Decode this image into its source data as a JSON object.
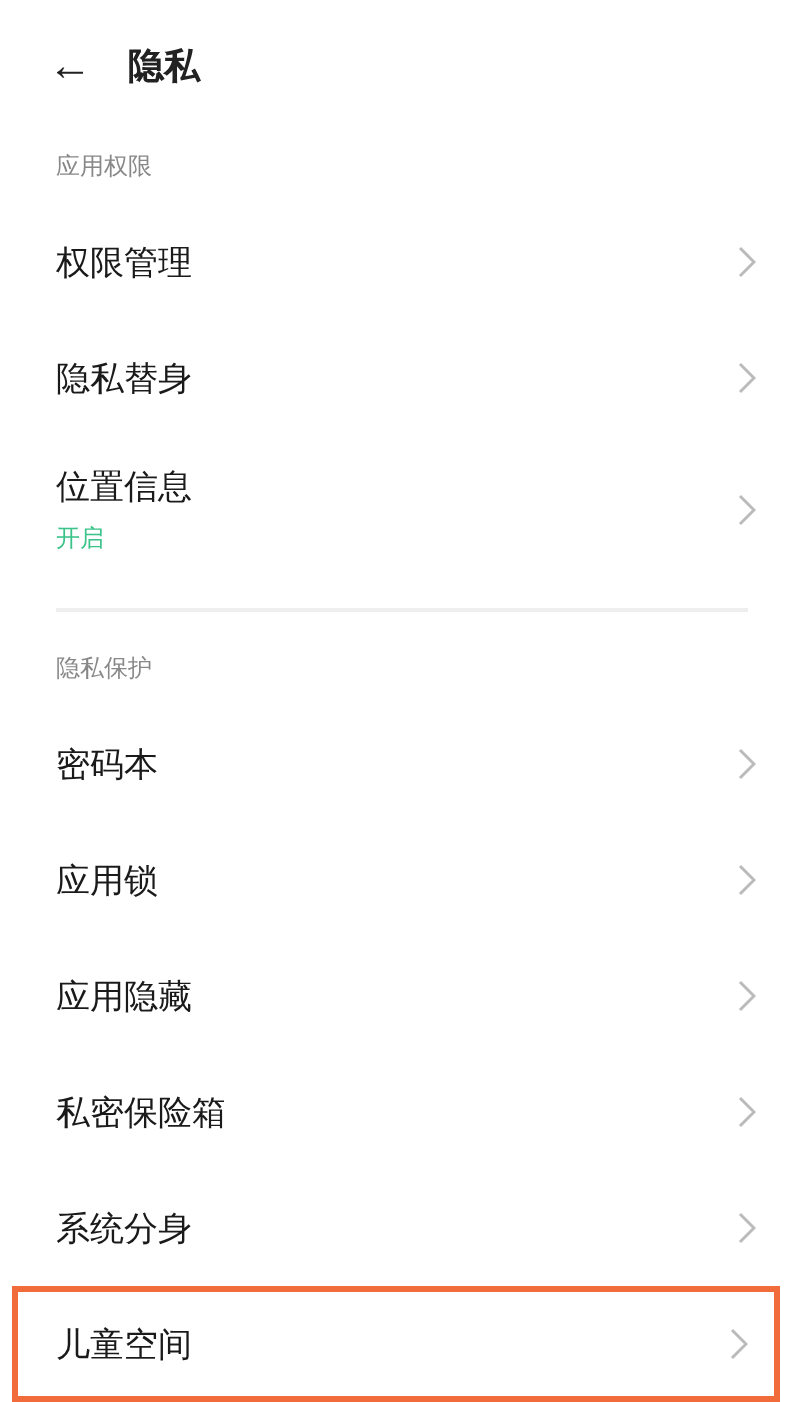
{
  "header": {
    "back_glyph": "←",
    "title": "隐私"
  },
  "sections": [
    {
      "label": "应用权限",
      "items": [
        {
          "title": "权限管理",
          "highlighted": false
        },
        {
          "title": "隐私替身",
          "highlighted": false
        },
        {
          "title": "位置信息",
          "status": "开启",
          "highlighted": false
        }
      ]
    },
    {
      "label": "隐私保护",
      "items": [
        {
          "title": "密码本",
          "highlighted": false
        },
        {
          "title": "应用锁",
          "highlighted": false
        },
        {
          "title": "应用隐藏",
          "highlighted": false
        },
        {
          "title": "私密保险箱",
          "highlighted": false
        },
        {
          "title": "系统分身",
          "highlighted": false
        },
        {
          "title": "儿童空间",
          "highlighted": true
        }
      ]
    }
  ]
}
